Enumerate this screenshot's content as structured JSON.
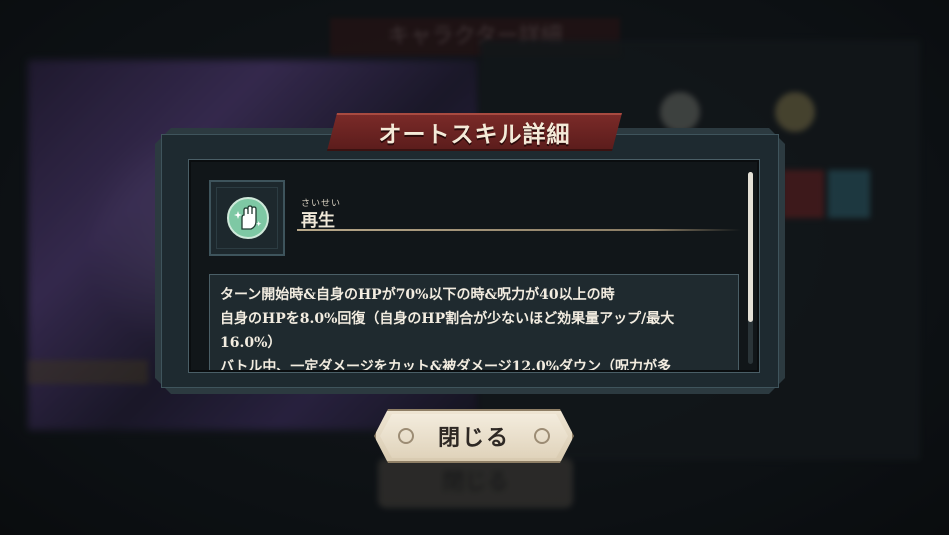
{
  "background": {
    "screen_title": "キャラクター詳細",
    "close_label": "閉じる"
  },
  "modal": {
    "title": "オートスキル詳細",
    "skill": {
      "icon": "healing-hand-icon",
      "ruby": "さいせい",
      "name": "再生"
    },
    "description": [
      "ターン開始時&自身のHPが70%以下の時&呪力が40以上の時",
      "自身のHPを8.0%回復（自身のHP割合が少ないほど効果量アップ/最大",
      "16.0%）",
      "バトル中、一定ダメージをカット&被ダメージ12.0%ダウン（呪力が多"
    ],
    "close_button": "閉じる"
  },
  "colors": {
    "ribbon": "#7a2a28",
    "icon_green": "#7ec8a4",
    "button_plate": "#efe6d4"
  }
}
